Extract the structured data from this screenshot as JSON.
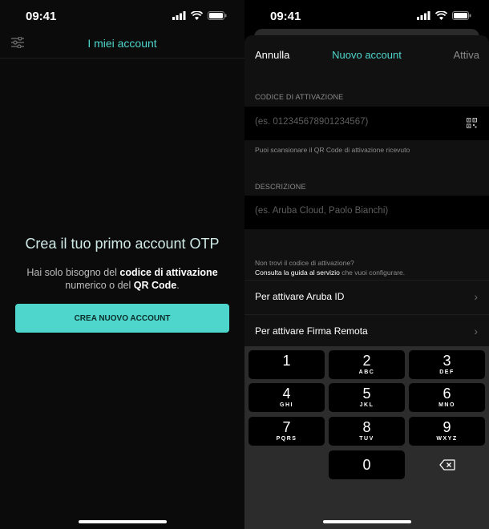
{
  "left": {
    "status_time": "09:41",
    "nav_title": "I miei account",
    "empty_title": "Crea il tuo primo account OTP",
    "empty_desc_1": "Hai solo bisogno del ",
    "empty_desc_b1": "codice di attivazione",
    "empty_desc_2": " numerico o del ",
    "empty_desc_b2": "QR Code",
    "empty_desc_3": ".",
    "cta_label": "CREA NUOVO ACCOUNT"
  },
  "right": {
    "status_time": "09:41",
    "header": {
      "cancel": "Annulla",
      "title": "Nuovo account",
      "activate": "Attiva"
    },
    "code_section": {
      "label": "CODICE DI ATTIVAZIONE",
      "placeholder": "(es. 012345678901234567)",
      "hint": "Puoi scansionare il QR Code di attivazione ricevuto"
    },
    "desc_section": {
      "label": "DESCRIZIONE",
      "placeholder": "(es. Aruba Cloud, Paolo Bianchi)"
    },
    "help_1": "Non trovi il codice di attivazione?",
    "help_link": "Consulta la guida al servizio",
    "help_2": " che vuoi configurare.",
    "links": [
      {
        "label": "Per attivare Aruba ID"
      },
      {
        "label": "Per attivare Firma Remota"
      }
    ],
    "keys": [
      {
        "digit": "1",
        "letters": ""
      },
      {
        "digit": "2",
        "letters": "ABC"
      },
      {
        "digit": "3",
        "letters": "DEF"
      },
      {
        "digit": "4",
        "letters": "GHI"
      },
      {
        "digit": "5",
        "letters": "JKL"
      },
      {
        "digit": "6",
        "letters": "MNO"
      },
      {
        "digit": "7",
        "letters": "PQRS"
      },
      {
        "digit": "8",
        "letters": "TUV"
      },
      {
        "digit": "9",
        "letters": "WXYZ"
      },
      {
        "digit": "0",
        "letters": ""
      }
    ]
  },
  "colors": {
    "accent": "#4fd6cc",
    "background": "#0b0b0b",
    "keyboard": "#2c2c2c"
  }
}
